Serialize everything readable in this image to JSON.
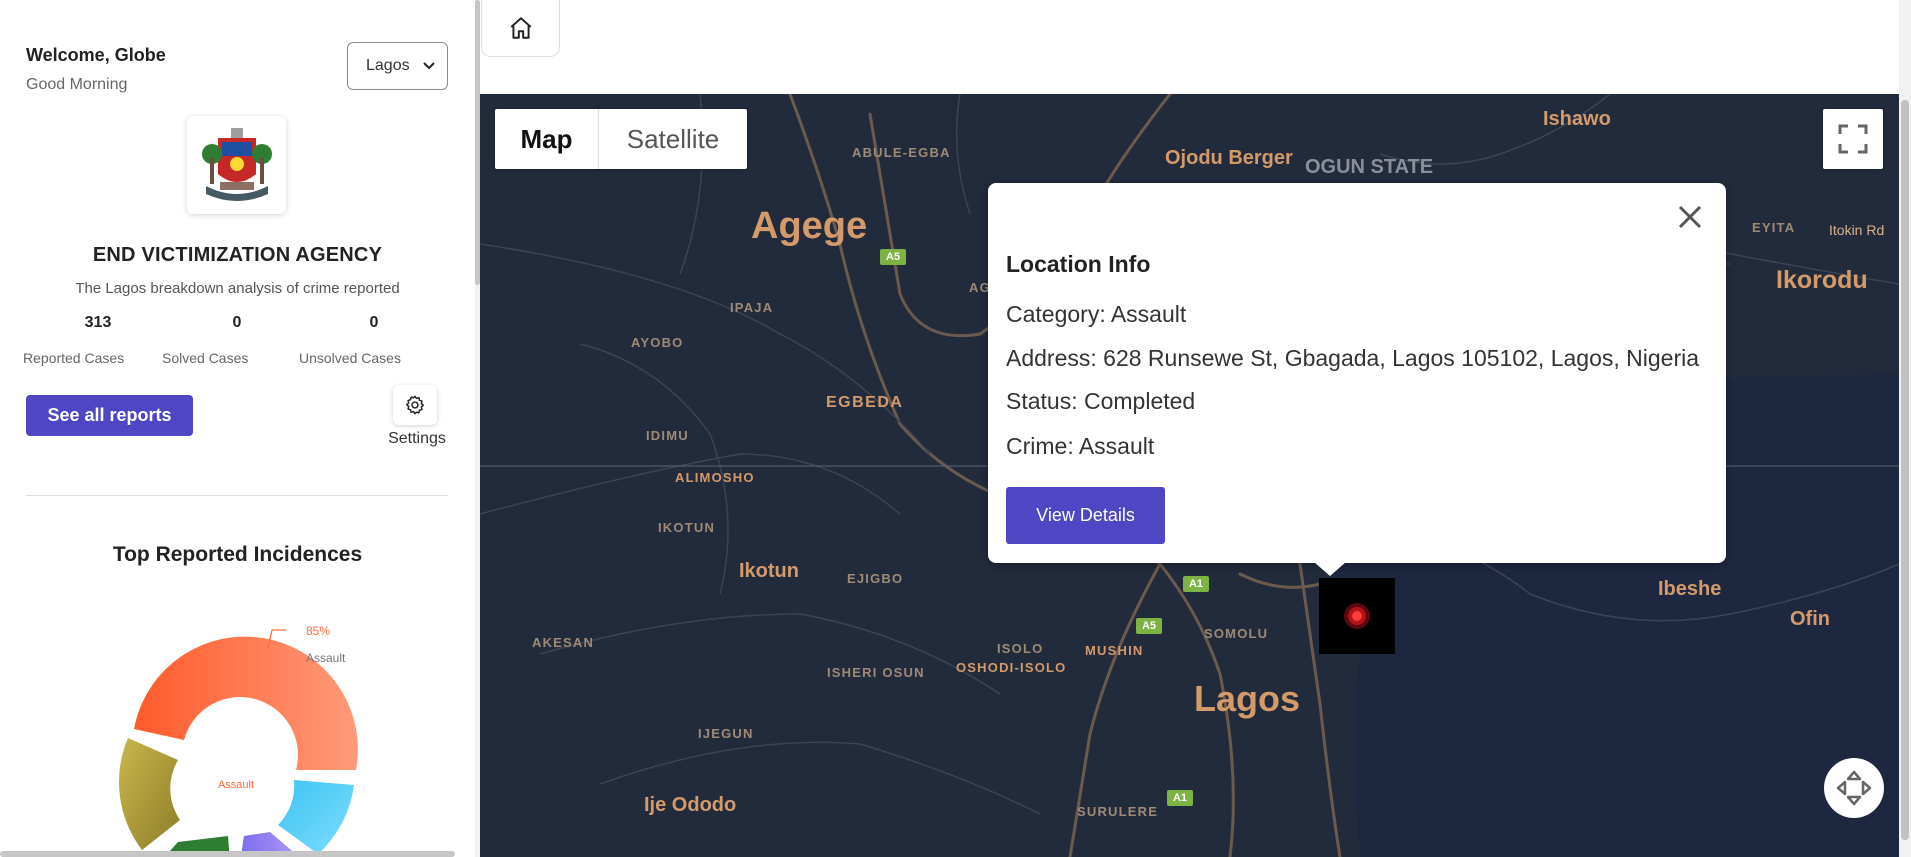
{
  "sidebar": {
    "welcome": "Welcome, Globe",
    "greeting": "Good Morning",
    "state_select": "Lagos",
    "agency_name": "END VICTIMIZATION AGENCY",
    "agency_subtitle": "The Lagos breakdown analysis of crime reported",
    "stats": [
      {
        "value": "313",
        "label": "Reported Cases"
      },
      {
        "value": "0",
        "label": "Solved Cases"
      },
      {
        "value": "0",
        "label": "Unsolved Cases"
      }
    ],
    "see_all_label": "See all reports",
    "settings_label": "Settings",
    "top_reported_title": "Top Reported Incidences"
  },
  "chart_data": {
    "type": "pie",
    "title": "Top Reported Incidences",
    "center_label": "Assault",
    "annotation": {
      "percent": "85%",
      "label": "Assault"
    },
    "slices": [
      {
        "label": "Assault",
        "value": 85,
        "color": "#ff6a3c"
      }
    ],
    "colors_visible": [
      "#ff6a3c",
      "#41c9f0",
      "#8b7be8",
      "#2e7d32",
      "#b7a43a"
    ]
  },
  "map": {
    "type_buttons": [
      "Map",
      "Satellite"
    ],
    "active_type": "Map",
    "labels": {
      "agege": "Agege",
      "ikorodu": "Ikorodu",
      "lagos": "Lagos",
      "ikotun": "Ikotun",
      "ije_ododo": "Ije Ododo",
      "ishawo": "Ishawo",
      "ojodu": "Ojodu Berger",
      "ogun": "OGUN STATE",
      "abule": "ABULE-EGBA",
      "ipaja": "IPAJA",
      "ayobo": "AYOBO",
      "egbeda": "EGBEDA",
      "idimu": "IDIMU",
      "alimosho": "ALIMOSHO",
      "ikotun_small": "IKOTUN",
      "ejigbo": "EJIGBO",
      "akesan": "AKESAN",
      "isheri": "ISHERI OSUN",
      "oshodi": "OSHODI-ISOLO",
      "isolo": "ISOLO",
      "mushin": "MUSHIN",
      "somolu": "SOMOLU",
      "ijegun": "IJEGUN",
      "surulere": "SURULERE",
      "ibeshe": "Ibeshe",
      "ofin": "Ofin",
      "eyita": "EYITA",
      "itokin": "Itokin Rd",
      "ag": "AG"
    },
    "shields": [
      "A5",
      "A1",
      "A5",
      "A1"
    ]
  },
  "popup": {
    "title": "Location Info",
    "category": "Category: Assault",
    "address": "Address: 628 Runsewe St, Gbagada, Lagos 105102, Lagos, Nigeria",
    "status": "Status: Completed",
    "crime": "Crime: Assault",
    "view_details_label": "View Details"
  }
}
